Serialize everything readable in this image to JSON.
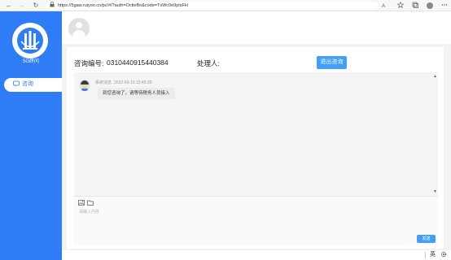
{
  "browser": {
    "back_icon": "←",
    "forward_icon": "→",
    "reload_icon": "↻",
    "lock_icon": "🔒",
    "url": "https://5gaw.ruiyoo.cn/pc/#/?auth=OctieBo&code=TvWc0e9pIsFH"
  },
  "sidebar": {
    "brand_name": "5G终问",
    "menu": [
      {
        "icon": "chat-bubble-icon",
        "label": "咨询"
      }
    ]
  },
  "consult": {
    "number_label": "咨询编号:",
    "number_value": "0310440915440384",
    "handler_label": "处理人:",
    "end_button": "退出咨询"
  },
  "chat": {
    "messages": [
      {
        "sender": "系统消息",
        "time": "2022-03-10 15:45:39",
        "text": "到您咨询了，请等待税务人员接入"
      }
    ]
  },
  "input": {
    "placeholder": "请输入内容",
    "send_button": "发送"
  },
  "tray": {
    "ime": "英"
  },
  "colors": {
    "primary": "#2f7df6",
    "button": "#409eff"
  }
}
